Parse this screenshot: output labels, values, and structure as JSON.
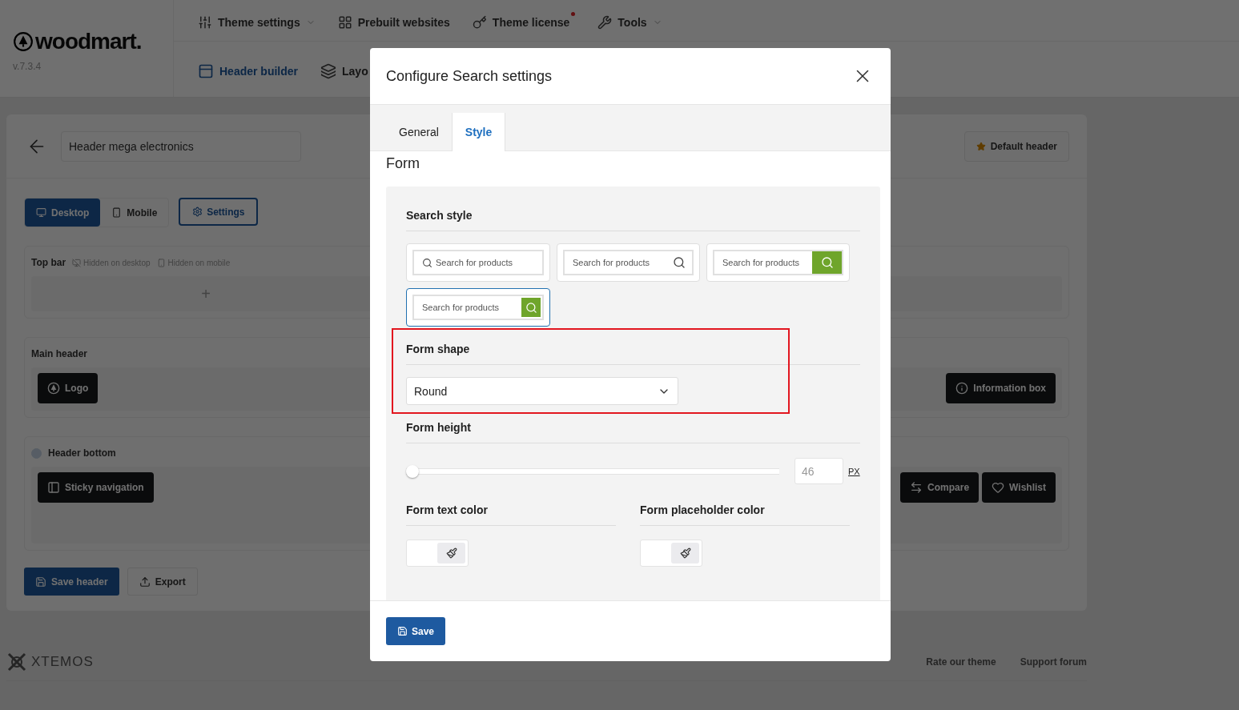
{
  "brand": {
    "logo": "woodmart.",
    "version": "v.7.3.4"
  },
  "top_nav": [
    {
      "label": "Theme settings",
      "dropdown": true
    },
    {
      "label": "Prebuilt websites"
    },
    {
      "label": "Theme license",
      "notify": true
    },
    {
      "label": "Tools",
      "dropdown": true
    }
  ],
  "sub_nav": [
    {
      "label": "Header builder",
      "selected": true
    },
    {
      "label": "Layo",
      "selected": false
    }
  ],
  "builder": {
    "header_name": "Header mega electronics",
    "default_button": "Default header",
    "devices": [
      {
        "label": "Desktop",
        "selected": true
      },
      {
        "label": "Mobile",
        "selected": false
      }
    ],
    "settings": "Settings",
    "rows": [
      {
        "title": "Top bar",
        "notes": [
          "Hidden on desktop",
          "Hidden on mobile"
        ],
        "add": "+",
        "left": [],
        "right": []
      },
      {
        "title": "Main header",
        "left": [
          {
            "kind": "logo",
            "label": "Logo"
          }
        ],
        "right": [
          {
            "kind": "info",
            "label": "Information box"
          }
        ]
      },
      {
        "title": "Header bottom",
        "toggle": true,
        "left": [
          {
            "kind": "sticky",
            "label": "Sticky navigation"
          }
        ],
        "right": [
          {
            "kind": "compare",
            "label": "Compare"
          },
          {
            "kind": "wishlist",
            "label": "Wishlist"
          }
        ]
      }
    ],
    "actions": [
      {
        "kind": "primary",
        "label": "Save header"
      },
      {
        "kind": "secondary",
        "label": "Export"
      }
    ]
  },
  "footer": {
    "brand": "XTEMOS",
    "links": [
      "Rate our theme",
      "Support forum"
    ]
  },
  "modal": {
    "title": "Configure Search settings",
    "tabs": [
      {
        "label": "General",
        "selected": false
      },
      {
        "label": "Style",
        "selected": true
      }
    ],
    "section": "Form",
    "search_style": {
      "label": "Search style",
      "options": [
        {
          "kind": "icon-left",
          "placeholder": "Search for products",
          "selected": false
        },
        {
          "kind": "icon-right",
          "placeholder": "Search for products",
          "selected": false
        },
        {
          "kind": "button-wide",
          "placeholder": "Search for products",
          "selected": false
        },
        {
          "kind": "button-small",
          "placeholder": "Search for products",
          "selected": true
        }
      ]
    },
    "form_shape": {
      "label": "Form shape",
      "value": "Round",
      "highlighted": true
    },
    "form_height": {
      "label": "Form height",
      "level": 0,
      "value": "46",
      "unit": "PX"
    },
    "colors": [
      {
        "label": "Form text color"
      },
      {
        "label": "Form placeholder color"
      }
    ],
    "save": "Save"
  }
}
